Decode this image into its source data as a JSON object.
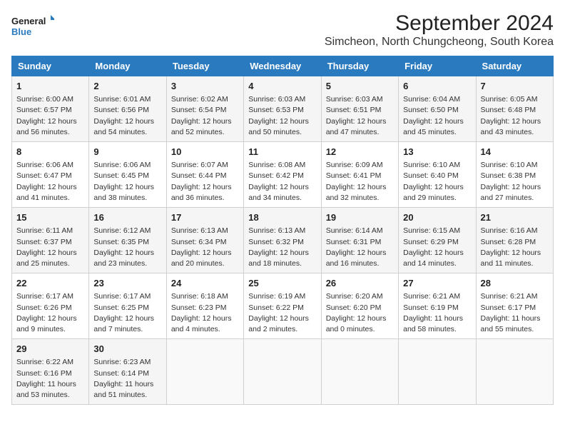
{
  "logo": {
    "line1": "General",
    "line2": "Blue"
  },
  "title": "September 2024",
  "subtitle": "Simcheon, North Chungcheong, South Korea",
  "weekdays": [
    "Sunday",
    "Monday",
    "Tuesday",
    "Wednesday",
    "Thursday",
    "Friday",
    "Saturday"
  ],
  "weeks": [
    [
      {
        "day": "1",
        "lines": [
          "Sunrise: 6:00 AM",
          "Sunset: 6:57 PM",
          "Daylight: 12 hours",
          "and 56 minutes."
        ]
      },
      {
        "day": "2",
        "lines": [
          "Sunrise: 6:01 AM",
          "Sunset: 6:56 PM",
          "Daylight: 12 hours",
          "and 54 minutes."
        ]
      },
      {
        "day": "3",
        "lines": [
          "Sunrise: 6:02 AM",
          "Sunset: 6:54 PM",
          "Daylight: 12 hours",
          "and 52 minutes."
        ]
      },
      {
        "day": "4",
        "lines": [
          "Sunrise: 6:03 AM",
          "Sunset: 6:53 PM",
          "Daylight: 12 hours",
          "and 50 minutes."
        ]
      },
      {
        "day": "5",
        "lines": [
          "Sunrise: 6:03 AM",
          "Sunset: 6:51 PM",
          "Daylight: 12 hours",
          "and 47 minutes."
        ]
      },
      {
        "day": "6",
        "lines": [
          "Sunrise: 6:04 AM",
          "Sunset: 6:50 PM",
          "Daylight: 12 hours",
          "and 45 minutes."
        ]
      },
      {
        "day": "7",
        "lines": [
          "Sunrise: 6:05 AM",
          "Sunset: 6:48 PM",
          "Daylight: 12 hours",
          "and 43 minutes."
        ]
      }
    ],
    [
      {
        "day": "8",
        "lines": [
          "Sunrise: 6:06 AM",
          "Sunset: 6:47 PM",
          "Daylight: 12 hours",
          "and 41 minutes."
        ]
      },
      {
        "day": "9",
        "lines": [
          "Sunrise: 6:06 AM",
          "Sunset: 6:45 PM",
          "Daylight: 12 hours",
          "and 38 minutes."
        ]
      },
      {
        "day": "10",
        "lines": [
          "Sunrise: 6:07 AM",
          "Sunset: 6:44 PM",
          "Daylight: 12 hours",
          "and 36 minutes."
        ]
      },
      {
        "day": "11",
        "lines": [
          "Sunrise: 6:08 AM",
          "Sunset: 6:42 PM",
          "Daylight: 12 hours",
          "and 34 minutes."
        ]
      },
      {
        "day": "12",
        "lines": [
          "Sunrise: 6:09 AM",
          "Sunset: 6:41 PM",
          "Daylight: 12 hours",
          "and 32 minutes."
        ]
      },
      {
        "day": "13",
        "lines": [
          "Sunrise: 6:10 AM",
          "Sunset: 6:40 PM",
          "Daylight: 12 hours",
          "and 29 minutes."
        ]
      },
      {
        "day": "14",
        "lines": [
          "Sunrise: 6:10 AM",
          "Sunset: 6:38 PM",
          "Daylight: 12 hours",
          "and 27 minutes."
        ]
      }
    ],
    [
      {
        "day": "15",
        "lines": [
          "Sunrise: 6:11 AM",
          "Sunset: 6:37 PM",
          "Daylight: 12 hours",
          "and 25 minutes."
        ]
      },
      {
        "day": "16",
        "lines": [
          "Sunrise: 6:12 AM",
          "Sunset: 6:35 PM",
          "Daylight: 12 hours",
          "and 23 minutes."
        ]
      },
      {
        "day": "17",
        "lines": [
          "Sunrise: 6:13 AM",
          "Sunset: 6:34 PM",
          "Daylight: 12 hours",
          "and 20 minutes."
        ]
      },
      {
        "day": "18",
        "lines": [
          "Sunrise: 6:13 AM",
          "Sunset: 6:32 PM",
          "Daylight: 12 hours",
          "and 18 minutes."
        ]
      },
      {
        "day": "19",
        "lines": [
          "Sunrise: 6:14 AM",
          "Sunset: 6:31 PM",
          "Daylight: 12 hours",
          "and 16 minutes."
        ]
      },
      {
        "day": "20",
        "lines": [
          "Sunrise: 6:15 AM",
          "Sunset: 6:29 PM",
          "Daylight: 12 hours",
          "and 14 minutes."
        ]
      },
      {
        "day": "21",
        "lines": [
          "Sunrise: 6:16 AM",
          "Sunset: 6:28 PM",
          "Daylight: 12 hours",
          "and 11 minutes."
        ]
      }
    ],
    [
      {
        "day": "22",
        "lines": [
          "Sunrise: 6:17 AM",
          "Sunset: 6:26 PM",
          "Daylight: 12 hours",
          "and 9 minutes."
        ]
      },
      {
        "day": "23",
        "lines": [
          "Sunrise: 6:17 AM",
          "Sunset: 6:25 PM",
          "Daylight: 12 hours",
          "and 7 minutes."
        ]
      },
      {
        "day": "24",
        "lines": [
          "Sunrise: 6:18 AM",
          "Sunset: 6:23 PM",
          "Daylight: 12 hours",
          "and 4 minutes."
        ]
      },
      {
        "day": "25",
        "lines": [
          "Sunrise: 6:19 AM",
          "Sunset: 6:22 PM",
          "Daylight: 12 hours",
          "and 2 minutes."
        ]
      },
      {
        "day": "26",
        "lines": [
          "Sunrise: 6:20 AM",
          "Sunset: 6:20 PM",
          "Daylight: 12 hours",
          "and 0 minutes."
        ]
      },
      {
        "day": "27",
        "lines": [
          "Sunrise: 6:21 AM",
          "Sunset: 6:19 PM",
          "Daylight: 11 hours",
          "and 58 minutes."
        ]
      },
      {
        "day": "28",
        "lines": [
          "Sunrise: 6:21 AM",
          "Sunset: 6:17 PM",
          "Daylight: 11 hours",
          "and 55 minutes."
        ]
      }
    ],
    [
      {
        "day": "29",
        "lines": [
          "Sunrise: 6:22 AM",
          "Sunset: 6:16 PM",
          "Daylight: 11 hours",
          "and 53 minutes."
        ]
      },
      {
        "day": "30",
        "lines": [
          "Sunrise: 6:23 AM",
          "Sunset: 6:14 PM",
          "Daylight: 11 hours",
          "and 51 minutes."
        ]
      },
      {
        "day": "",
        "lines": []
      },
      {
        "day": "",
        "lines": []
      },
      {
        "day": "",
        "lines": []
      },
      {
        "day": "",
        "lines": []
      },
      {
        "day": "",
        "lines": []
      }
    ]
  ]
}
